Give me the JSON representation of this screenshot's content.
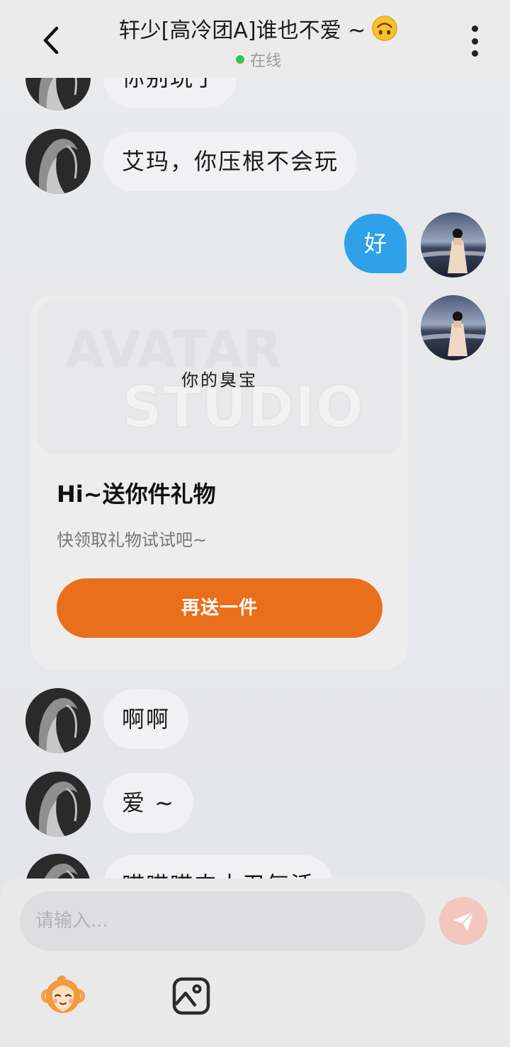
{
  "header": {
    "title": "轩少[高冷团A]谁也不爱 ~",
    "title_emoji": "upside-down-face-emoji",
    "status": "在线",
    "status_color": "#3ec14b"
  },
  "messages": [
    {
      "side": "left",
      "text": "你别玩了"
    },
    {
      "side": "left",
      "text": "艾玛，你压根不会玩"
    },
    {
      "side": "right",
      "text": "好"
    },
    {
      "side": "right",
      "type": "gift-card"
    },
    {
      "side": "left",
      "text": "啊啊"
    },
    {
      "side": "left",
      "text": "爱 ~"
    },
    {
      "side": "left",
      "text": "喵喵喵丰十卫气活"
    }
  ],
  "gift_card": {
    "image_caption": "你的臭宝",
    "watermark_line1": "AVATAR",
    "watermark_line2": "STUDIO",
    "title": "Hi~送你件礼物",
    "subtitle": "快领取礼物试试吧~",
    "button_label": "再送一件",
    "button_color": "#e96f1a"
  },
  "composer": {
    "placeholder": "请输入...",
    "send_icon": "paper-plane-icon",
    "sticker_icon": "monkey-sticker-icon",
    "image_icon": "image-icon"
  },
  "colors": {
    "outgoing_bubble": "#2ea1ea",
    "incoming_bubble": "#f1f1f3",
    "background": "#e6e7ea"
  }
}
